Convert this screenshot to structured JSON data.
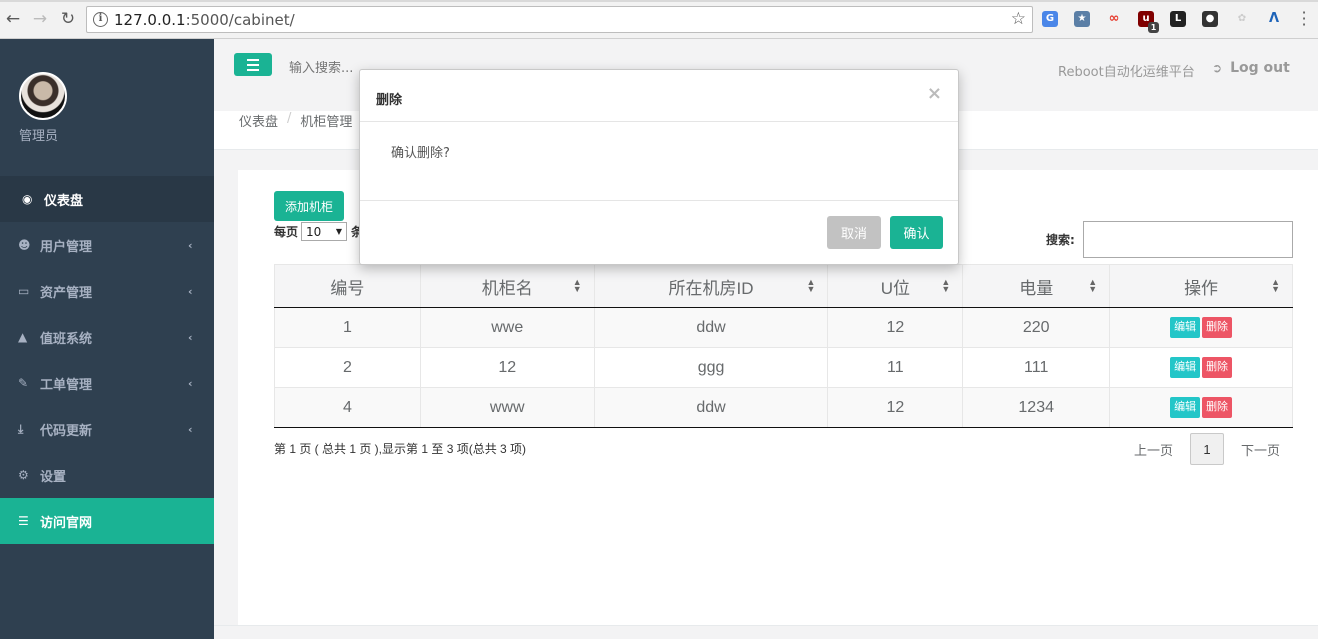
{
  "browser": {
    "url_host": "127.0.0.1",
    "url_path": ":5000/cabinet/",
    "ext_badge": "1"
  },
  "sidebar": {
    "user_name": "管理员",
    "items": [
      {
        "label": "仪表盘",
        "icon": "dashboard-icon"
      },
      {
        "label": "用户管理",
        "icon": "users-icon"
      },
      {
        "label": "资产管理",
        "icon": "inbox-icon"
      },
      {
        "label": "值班系统",
        "icon": "bell-icon"
      },
      {
        "label": "工单管理",
        "icon": "edit-icon"
      },
      {
        "label": "代码更新",
        "icon": "download-icon"
      },
      {
        "label": "设置",
        "icon": "gears-icon"
      },
      {
        "label": "访问官网",
        "icon": "database-icon"
      }
    ]
  },
  "header": {
    "search_placeholder": "输入搜索...",
    "brand": "Reboot自动化运维平台",
    "logout": "Log out"
  },
  "breadcrumb": [
    "仪表盘",
    "机柜管理"
  ],
  "toolbar": {
    "add_label": "添加机柜",
    "per_page_label": "每页",
    "per_page_value": "10",
    "per_page_trail": "条",
    "search_label": "搜索:"
  },
  "table": {
    "columns": [
      "编号",
      "机柜名",
      "所在机房ID",
      "U位",
      "电量",
      "操作"
    ],
    "rows": [
      {
        "id": "1",
        "name": "wwe",
        "room": "ddw",
        "u": "12",
        "power": "220"
      },
      {
        "id": "2",
        "name": "12",
        "room": "ggg",
        "u": "11",
        "power": "111"
      },
      {
        "id": "4",
        "name": "www",
        "room": "ddw",
        "u": "12",
        "power": "1234"
      }
    ],
    "edit_label": "编辑",
    "delete_label": "删除"
  },
  "footer": {
    "info": "第 1 页 ( 总共 1 页 ),显示第 1 至 3 项(总共 3 项)",
    "prev": "上一页",
    "current": "1",
    "next": "下一页"
  },
  "modal": {
    "title": "删除",
    "close": "×",
    "body": "确认删除?",
    "cancel": "取消",
    "confirm": "确认"
  },
  "colors": {
    "accent": "#1ab394",
    "sidebar": "#2f4050",
    "danger": "#ed5565",
    "info": "#23c6c8"
  }
}
